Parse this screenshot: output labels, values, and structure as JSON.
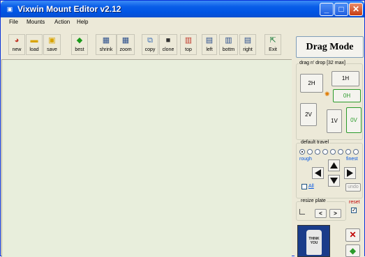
{
  "window": {
    "title": "Vixwin Mount Editor v2.12",
    "minimize": "_",
    "maximize": "□",
    "close": "✕"
  },
  "menu": [
    "File",
    "Mounts",
    "Action",
    "Help"
  ],
  "toolbar": {
    "new": "new",
    "load": "load",
    "save": "save",
    "best": "best",
    "shrink": "shrink",
    "zoom": "zoom",
    "copy": "copy",
    "clone": "clone",
    "top": "top",
    "left": "left",
    "bottom": "bottm",
    "right": "right",
    "exit": "Exit"
  },
  "drag_mode": "Drag Mode",
  "panel": {
    "drag_drop_legend": "drag n' drop [32 max]",
    "btn_2h": "2H",
    "btn_1h": "1H",
    "btn_0h": "0H",
    "btn_2v": "2V",
    "btn_1v": "1V",
    "btn_0v": "0V",
    "travel_legend": "default travel",
    "travel_selected_index": 0,
    "travel_option_count": 8,
    "rough": "rough",
    "finest": "finest",
    "all": "All",
    "undo": "undo",
    "resize_legend": "resize plate",
    "reset": "reset",
    "prev": "<",
    "next": ">",
    "preview_text": "THINK YOU",
    "colors": {
      "accent_blue": "#0054e3",
      "green_btn": "#2a9a2a",
      "red_reset": "#c00000"
    }
  }
}
